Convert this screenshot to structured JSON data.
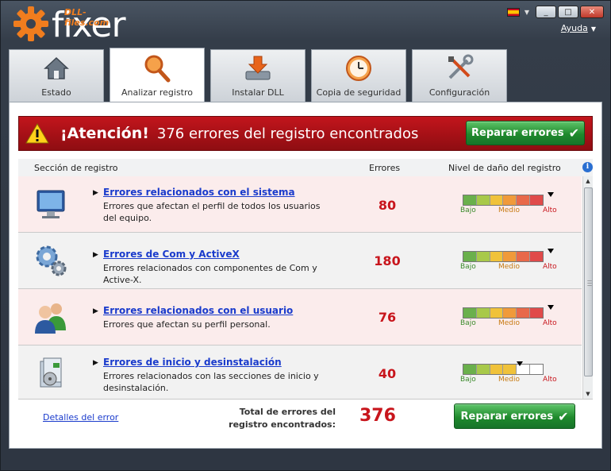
{
  "app": {
    "logo_sub": "DLL-files.com",
    "logo_word": "fixer",
    "help_label": "Ayuda",
    "window": {
      "minimize": "_",
      "maximize": "□",
      "close": "✕"
    }
  },
  "tabs": [
    {
      "label": "Estado",
      "icon": "house-icon",
      "active": false
    },
    {
      "label": "Analizar registro",
      "icon": "magnifier-icon",
      "active": true
    },
    {
      "label": "Instalar DLL",
      "icon": "download-drive-icon",
      "active": false
    },
    {
      "label": "Copia de seguridad",
      "icon": "clock-backup-icon",
      "active": false
    },
    {
      "label": "Configuración",
      "icon": "tools-icon",
      "active": false
    }
  ],
  "alert": {
    "title": "¡Atención!",
    "message": "376 errores del registro encontrados",
    "button_label": "Reparar errores"
  },
  "table": {
    "headers": {
      "section": "Sección de registro",
      "errors": "Errores",
      "damage": "Nivel de daño del registro"
    },
    "meter_labels": {
      "low": "Bajo",
      "medium": "Medio",
      "high": "Alto"
    },
    "rows": [
      {
        "title": "Errores relacionados con el sistema",
        "desc": "Errores que afectan el perfil de todos los usuarios del equipo.",
        "count": "80",
        "icon": "monitor-icon",
        "level": 1.0
      },
      {
        "title": "Errores de Com y ActiveX",
        "desc": "Errores relacionados con componentes de Com y Active-X.",
        "count": "180",
        "icon": "gears-icon",
        "level": 1.0
      },
      {
        "title": "Errores relacionados con el usuario",
        "desc": "Errores que afectan su perfil personal.",
        "count": "76",
        "icon": "users-icon",
        "level": 1.0
      },
      {
        "title": "Errores de inicio y desinstalación",
        "desc": "Errores relacionados con las secciones de inicio y desinstalación.",
        "count": "40",
        "icon": "installer-box-icon",
        "level": 0.6
      }
    ]
  },
  "footer": {
    "details_link": "Detalles del error",
    "total_label": "Total de errores del registro encontrados:",
    "total_value": "376",
    "button_label": "Reparar errores"
  },
  "colors": {
    "alert_red": "#b01218",
    "count_red": "#c8151c",
    "link_blue": "#1a3bcc",
    "button_green": "#1f8a2c"
  }
}
